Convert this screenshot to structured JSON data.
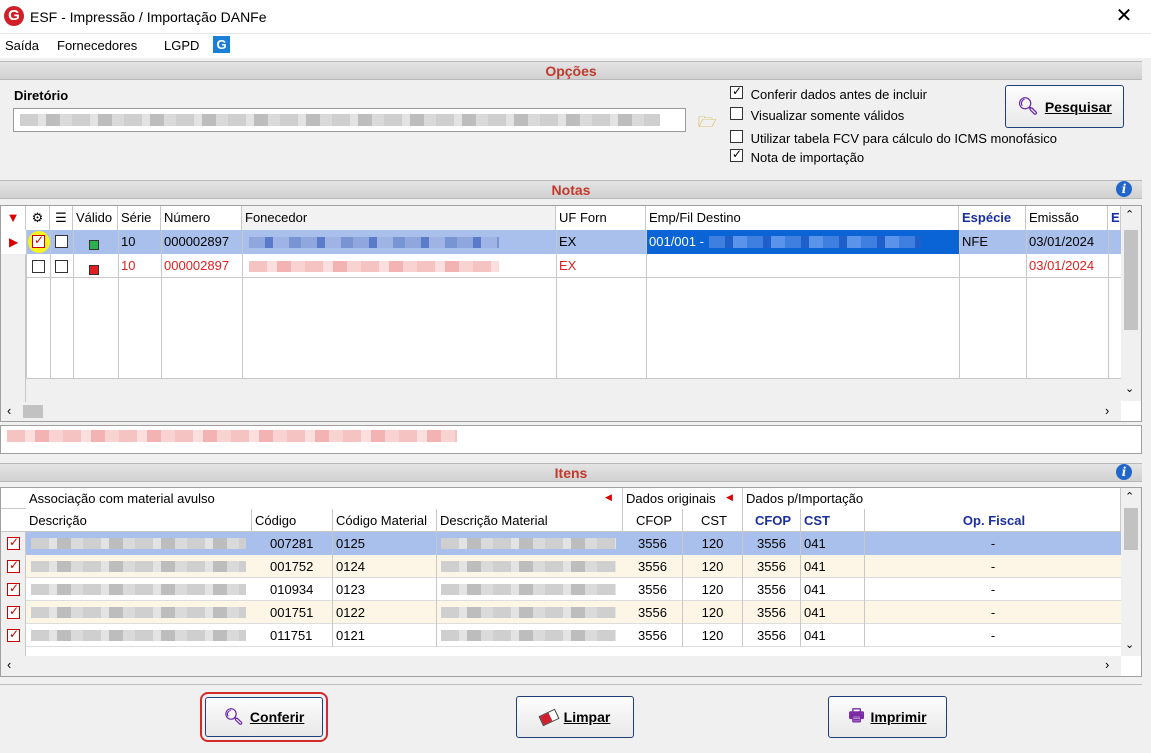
{
  "window": {
    "title": "ESF - Impressão / Importação DANFe",
    "logo": "G"
  },
  "menu": {
    "items": [
      "Saída",
      "Fornecedores",
      "LGPD"
    ]
  },
  "options": {
    "header": "Opções",
    "directory_label": "Diretório",
    "directory_value": "",
    "checks": [
      {
        "label": "Conferir dados antes de incluir",
        "checked": true
      },
      {
        "label": "Visualizar somente válidos",
        "checked": false
      },
      {
        "label": "Utilizar tabela FCV para cálculo do ICMS monofásico",
        "checked": false
      },
      {
        "label": "Nota de importação",
        "checked": true
      }
    ],
    "search_button": "Pesquisar"
  },
  "notas": {
    "header": "Notas",
    "columns": [
      "Válido",
      "Série",
      "Número",
      "Fonecedor",
      "UF Forn",
      "Emp/Fil Destino",
      "Espécie",
      "Emissão",
      "E"
    ],
    "rows": [
      {
        "serie": "10",
        "numero": "000002897",
        "uf": "EX",
        "destino": "001/001 -",
        "especie": "NFE",
        "emissao": "03/01/2024",
        "valid_color": "#2bb24c",
        "checked": true,
        "text_color": "#000000"
      },
      {
        "serie": "10",
        "numero": "000002897",
        "uf": "EX",
        "destino": "",
        "especie": "",
        "emissao": "03/01/2024",
        "valid_color": "#e02020",
        "checked": false,
        "text_color": "#e02020"
      }
    ]
  },
  "itens": {
    "header": "Itens",
    "group_headers": [
      "Associação com material avulso",
      "Dados originais",
      "Dados p/Importação"
    ],
    "columns": [
      "Descrição",
      "Código",
      "Código Material",
      "Descrição Material",
      "CFOP",
      "CST",
      "CFOP",
      "CST",
      "Op. Fiscal"
    ],
    "rows": [
      {
        "codigo": "007281",
        "cod_mat": "0125",
        "cfop_o": "3556",
        "cst_o": "120",
        "cfop_i": "3556",
        "cst_i": "041",
        "op": "-"
      },
      {
        "codigo": "001752",
        "cod_mat": "0124",
        "cfop_o": "3556",
        "cst_o": "120",
        "cfop_i": "3556",
        "cst_i": "041",
        "op": "-"
      },
      {
        "codigo": "010934",
        "cod_mat": "0123",
        "cfop_o": "3556",
        "cst_o": "120",
        "cfop_i": "3556",
        "cst_i": "041",
        "op": "-"
      },
      {
        "codigo": "001751",
        "cod_mat": "0122",
        "cfop_o": "3556",
        "cst_o": "120",
        "cfop_i": "3556",
        "cst_i": "041",
        "op": "-"
      },
      {
        "codigo": "011751",
        "cod_mat": "0121",
        "cfop_o": "3556",
        "cst_o": "120",
        "cfop_i": "3556",
        "cst_i": "041",
        "op": "-"
      }
    ]
  },
  "buttons": {
    "conferir": "Conferir",
    "limpar": "Limpar",
    "imprimir": "Imprimir"
  },
  "colors": {
    "accent_red": "#c0392b",
    "selection": "#a9c0ec",
    "highlight_circle": "#f7f31e"
  }
}
